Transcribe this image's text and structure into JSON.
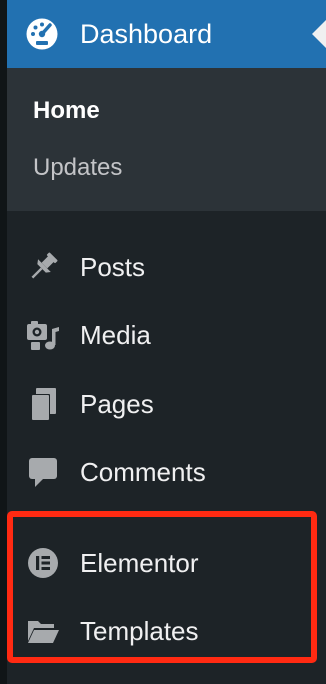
{
  "dashboard": {
    "label": "Dashboard",
    "icon": "dashboard-gauge-icon",
    "submenu": {
      "home": "Home",
      "updates": "Updates"
    }
  },
  "menu": {
    "posts": {
      "label": "Posts",
      "icon": "pushpin-icon"
    },
    "media": {
      "label": "Media",
      "icon": "media-icon"
    },
    "pages": {
      "label": "Pages",
      "icon": "pages-icon"
    },
    "comments": {
      "label": "Comments",
      "icon": "comment-bubble-icon"
    },
    "elementor": {
      "label": "Elementor",
      "icon": "elementor-logo-icon"
    },
    "templates": {
      "label": "Templates",
      "icon": "folder-open-icon"
    }
  },
  "colors": {
    "admin_bar_bg": "#1d2327",
    "active_blue": "#2271b1",
    "submenu_bg": "#2c3338",
    "icon_gray": "#a7aaad",
    "highlight_red": "#ff2a12"
  }
}
